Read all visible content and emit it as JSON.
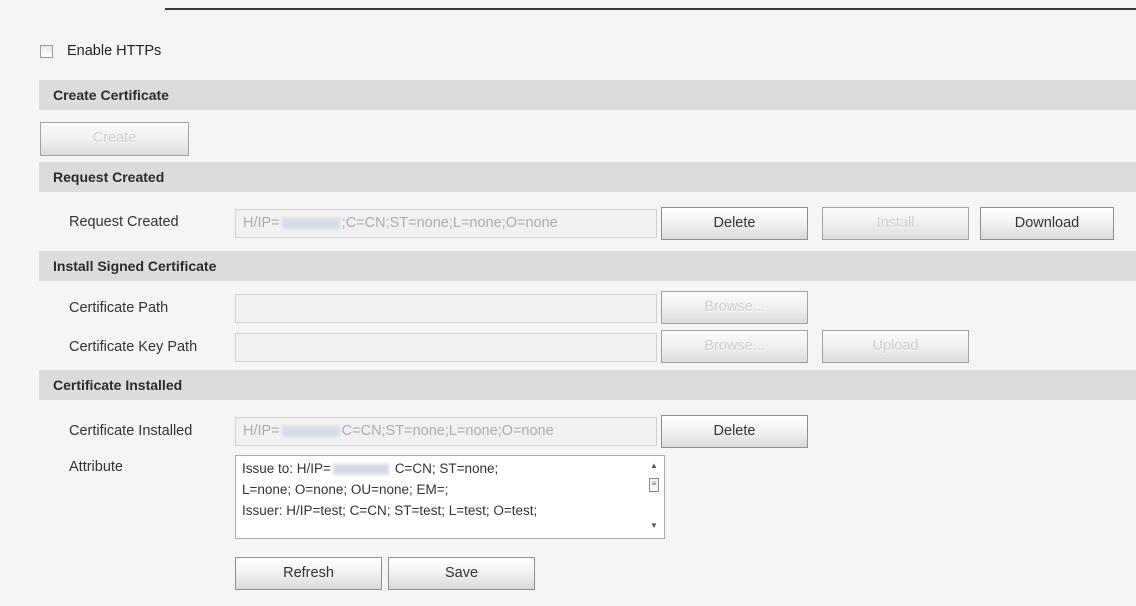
{
  "enable_https": {
    "label": "Enable HTTPs",
    "checked": false
  },
  "create_certificate": {
    "title": "Create Certificate",
    "create_label": "Create"
  },
  "request_created": {
    "title": "Request Created",
    "row_label": "Request Created",
    "value_prefix": "H/IP=",
    "value_suffix": ";C=CN;ST=none;L=none;O=none",
    "delete_label": "Delete",
    "install_label": "Install",
    "download_label": "Download"
  },
  "install_signed": {
    "title": "Install Signed Certificate",
    "cert_path_label": "Certificate Path",
    "cert_path_value": "",
    "key_path_label": "Certificate Key Path",
    "key_path_value": "",
    "browse_label": "Browse...",
    "browse_key_label": "Browse...",
    "upload_label": "Upload"
  },
  "installed": {
    "title": "Certificate Installed",
    "row_label": "Certificate Installed",
    "value_prefix": "H/IP=",
    "value_suffix": "C=CN;ST=none;L=none;O=none",
    "delete_label": "Delete",
    "attribute_label": "Attribute",
    "attribute_line1_prefix": "Issue to: H/IP=",
    "attribute_line1_suffix": "C=CN; ST=none;",
    "attribute_line2": "L=none; O=none; OU=none; EM=;",
    "attribute_line3": "Issuer: H/IP=test; C=CN; ST=test; L=test; O=test;"
  },
  "actions": {
    "refresh_label": "Refresh",
    "save_label": "Save"
  },
  "icons": {
    "scroll_up": "scroll-up-arrow-icon",
    "scroll_down": "scroll-down-arrow-icon",
    "scroll_thumb": "scroll-thumb-icon"
  }
}
